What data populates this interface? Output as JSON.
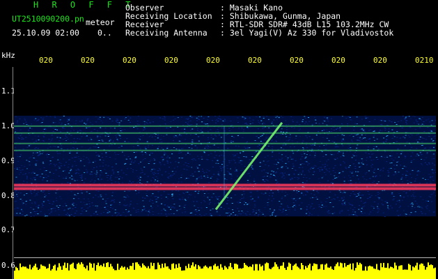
{
  "header": {
    "brand": "H R O F F T",
    "filename": "UT2510090200.pn",
    "overlay_label": "meteor",
    "datetime": "25.10.09 02:00",
    "datetime_suffix": "0..",
    "fields": [
      {
        "key": "Observer",
        "value": ": Masaki Kano"
      },
      {
        "key": "Receiving Location",
        "value": ": Shibukawa, Gunma, Japan"
      },
      {
        "key": "Receiver",
        "value": ": RTL-SDR SDR# 43dB L15 103.2MHz CW"
      },
      {
        "key": "Receiving Antenna",
        "value": ": 3el Yagi(V) Az 330 for Vladivostok"
      }
    ]
  },
  "time_axis": {
    "ticks": [
      "020",
      "020",
      "020",
      "020",
      "020",
      "020",
      "020",
      "020",
      "020",
      "0210"
    ]
  },
  "freq_axis": {
    "unit": "kHz",
    "labels": [
      "1.1",
      "1.0",
      "0.9",
      "0.8",
      "0.7",
      "0.6"
    ]
  },
  "colors": {
    "header_label": "#19e619",
    "tick_label": "#ffff33",
    "background": "#000000",
    "noise_low": "#0a2a8c",
    "noise_high": "#2fb3ff",
    "carrier": "#ff3b5c",
    "amplitude": "#ffff00"
  },
  "chart_data": {
    "type": "heatmap",
    "xlabel": "",
    "ylabel": "kHz",
    "ylim": [
      0.6,
      1.1
    ],
    "bands_khz": [
      0.83,
      0.82,
      0.93,
      0.95,
      0.98,
      1.0
    ],
    "meteor_trail_khz": [
      0.76,
      1.01
    ]
  }
}
